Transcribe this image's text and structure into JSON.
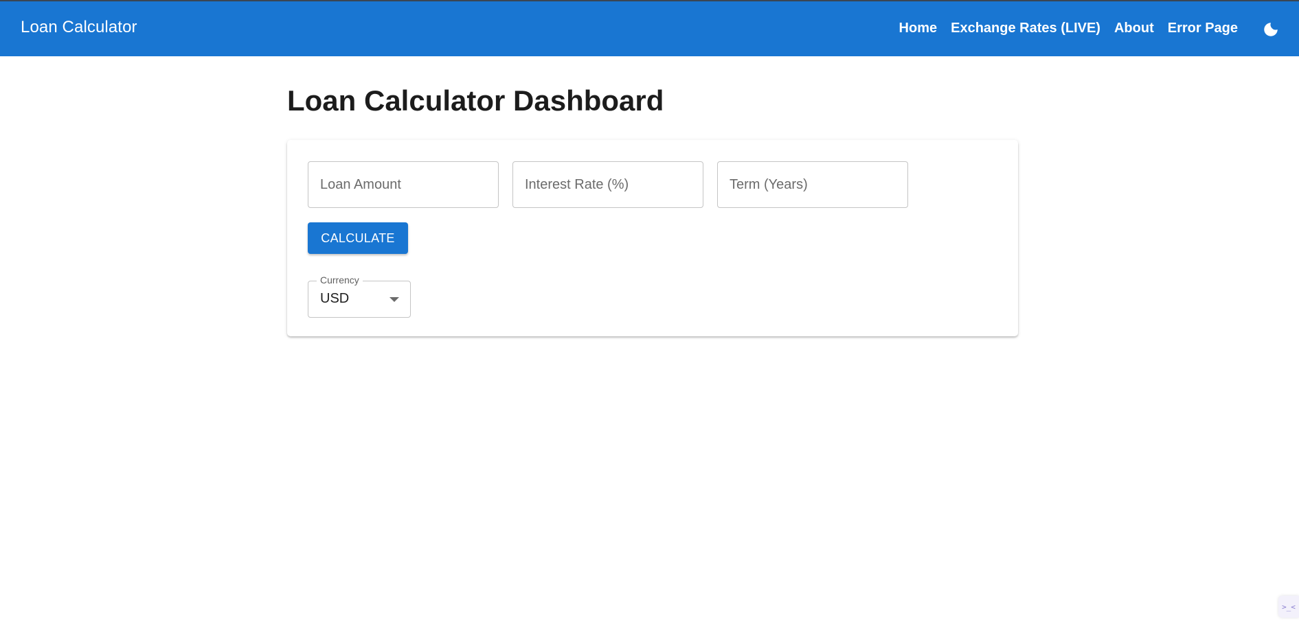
{
  "header": {
    "brand": "Loan Calculator",
    "nav": [
      "Home",
      "Exchange Rates (LIVE)",
      "About",
      "Error Page"
    ],
    "theme_icon": "moon-icon",
    "bg_color": "#1976d2"
  },
  "main": {
    "title": "Loan Calculator Dashboard",
    "form": {
      "loan_amount_placeholder": "Loan Amount",
      "interest_rate_placeholder": "Interest Rate (%)",
      "term_placeholder": "Term (Years)",
      "calculate_label": "CALCULATE",
      "currency_label": "Currency",
      "currency_value": "USD"
    }
  },
  "widget": {
    "label": ">_<"
  },
  "colors": {
    "accent": "#1976d2",
    "text": "#1f1f1f"
  }
}
